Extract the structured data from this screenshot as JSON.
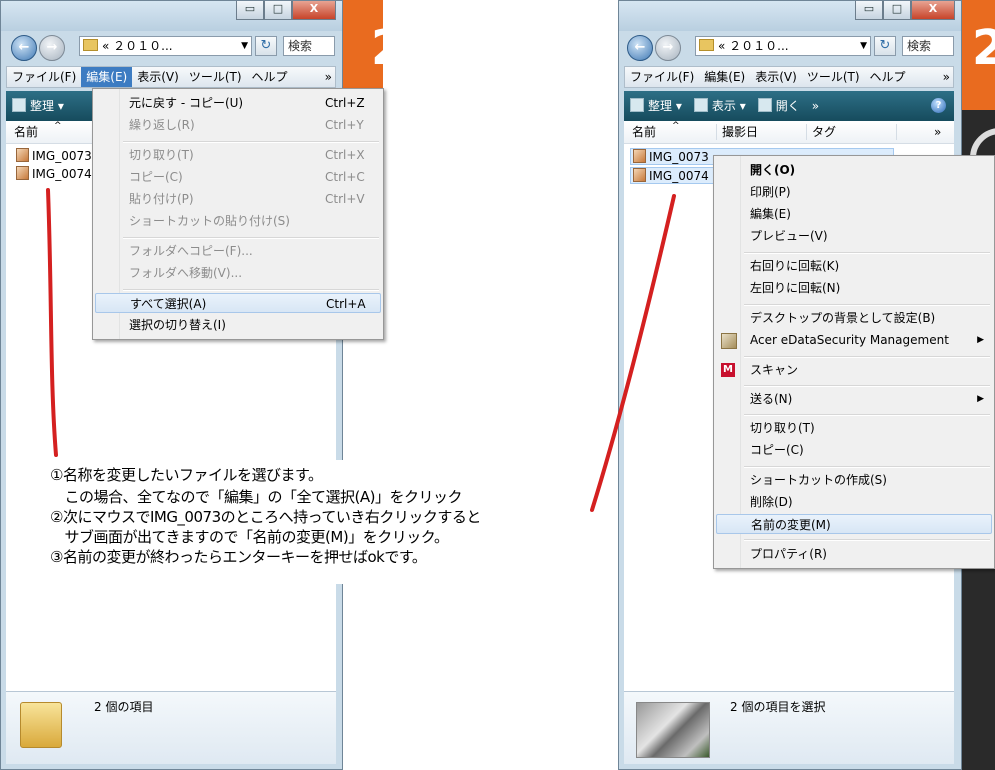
{
  "colors": {
    "accent": "#3d7cc2",
    "annotation_line": "#d42020",
    "orange": "#e96b1f",
    "toolbar": "#1f5e73"
  },
  "left_window": {
    "caption": {
      "minimize": "▭",
      "maximize": "□",
      "close": "X"
    },
    "address": "« ２０１０...",
    "search_placeholder": "検索",
    "menubar": [
      "ファイル(F)",
      "編集(E)",
      "表示(V)",
      "ツール(T)",
      "ヘルプ"
    ],
    "menubar_more": "»",
    "toolbar_organize": "整理",
    "column_name": "名前",
    "files": [
      "IMG_0073",
      "IMG_0074"
    ],
    "status": "2 個の項目"
  },
  "edit_menu": [
    {
      "label": "元に戻す - コピー(U)",
      "accel": "Ctrl+Z",
      "disabled": false
    },
    {
      "label": "繰り返し(R)",
      "accel": "Ctrl+Y",
      "disabled": true
    },
    {
      "label": "切り取り(T)",
      "accel": "Ctrl+X",
      "disabled": true
    },
    {
      "label": "コピー(C)",
      "accel": "Ctrl+C",
      "disabled": true
    },
    {
      "label": "貼り付け(P)",
      "accel": "Ctrl+V",
      "disabled": true
    },
    {
      "label": "ショートカットの貼り付け(S)",
      "accel": "",
      "disabled": true
    },
    {
      "label": "フォルダへコピー(F)...",
      "accel": "",
      "disabled": true
    },
    {
      "label": "フォルダへ移動(V)...",
      "accel": "",
      "disabled": true
    },
    {
      "label": "すべて選択(A)",
      "accel": "Ctrl+A",
      "disabled": false
    },
    {
      "label": "選択の切り替え(I)",
      "accel": "",
      "disabled": false
    }
  ],
  "right_window": {
    "caption": {
      "minimize": "▭",
      "maximize": "□",
      "close": "X"
    },
    "address": "« ２０１０...",
    "search_placeholder": "検索",
    "menubar": [
      "ファイル(F)",
      "編集(E)",
      "表示(V)",
      "ツール(T)",
      "ヘルプ"
    ],
    "menubar_more": "»",
    "toolbar": {
      "organize": "整理",
      "view": "表示",
      "open": "開く",
      "more": "»",
      "help": "?"
    },
    "columns": [
      "名前",
      "撮影日",
      "タグ"
    ],
    "columns_more": "»",
    "files": [
      "IMG_0073",
      "IMG_0074"
    ],
    "status": "2 個の項目を選択"
  },
  "context_menu": [
    {
      "label": "開く(O)",
      "bold": true
    },
    {
      "label": "印刷(P)"
    },
    {
      "label": "編集(E)"
    },
    {
      "label": "プレビュー(V)"
    },
    {
      "label": "右回りに回転(K)"
    },
    {
      "label": "左回りに回転(N)"
    },
    {
      "label": "デスクトップの背景として設定(B)"
    },
    {
      "label": "Acer eDataSecurity Management",
      "submenu": true,
      "icon": "acer-icon"
    },
    {
      "label": "スキャン",
      "icon": "mcafee-icon"
    },
    {
      "label": "送る(N)",
      "submenu": true
    },
    {
      "label": "切り取り(T)"
    },
    {
      "label": "コピー(C)"
    },
    {
      "label": "ショートカットの作成(S)"
    },
    {
      "label": "削除(D)"
    },
    {
      "label": "名前の変更(M)",
      "highlight": true
    },
    {
      "label": "プロパティ(R)"
    }
  ],
  "side_labels": {
    "left_number": "2",
    "right_number": "2"
  },
  "instructions": [
    "①名称を変更したいファイルを選びます。",
    "　この場合、全てなので「編集」の「全て選択(A)」をクリック",
    "②次にマウスでIMG_0073のところへ持っていき右クリックすると",
    "　サブ画面が出てきますので「名前の変更(M)」をクリック。",
    "③名前の変更が終わったらエンターキーを押せばokです。"
  ]
}
